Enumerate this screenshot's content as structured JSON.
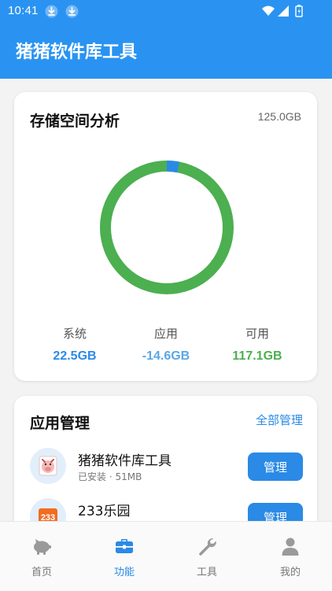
{
  "status_bar": {
    "time": "10:41"
  },
  "app_bar": {
    "title": "猪猪软件库工具"
  },
  "storage": {
    "title": "存储空间分析",
    "total": "125.0GB",
    "stats": [
      {
        "label": "系统",
        "value": "22.5GB",
        "color": "#2a8ae6"
      },
      {
        "label": "应用",
        "value": "-14.6GB",
        "color": "#5aa7e8"
      },
      {
        "label": "可用",
        "value": "117.1GB",
        "color": "#4caf50"
      }
    ],
    "ring_colors": {
      "used": "#2a8ae6",
      "free": "#4caf50"
    },
    "used_fraction": 0.03
  },
  "apps": {
    "title": "应用管理",
    "manage_all": "全部管理",
    "items": [
      {
        "name": "猪猪软件库工具",
        "sub": "已安装 · 51MB",
        "button": "管理"
      },
      {
        "name": "233乐园",
        "sub": "",
        "button": "管理",
        "icon_text": "233"
      }
    ]
  },
  "nav": {
    "items": [
      {
        "label": "首页",
        "icon": "piggy-bank-icon"
      },
      {
        "label": "功能",
        "icon": "toolbox-icon",
        "active": true
      },
      {
        "label": "工具",
        "icon": "wrench-icon"
      },
      {
        "label": "我的",
        "icon": "user-icon"
      }
    ],
    "active_color": "#2a8ae6",
    "inactive_color": "#9a9a9a"
  }
}
